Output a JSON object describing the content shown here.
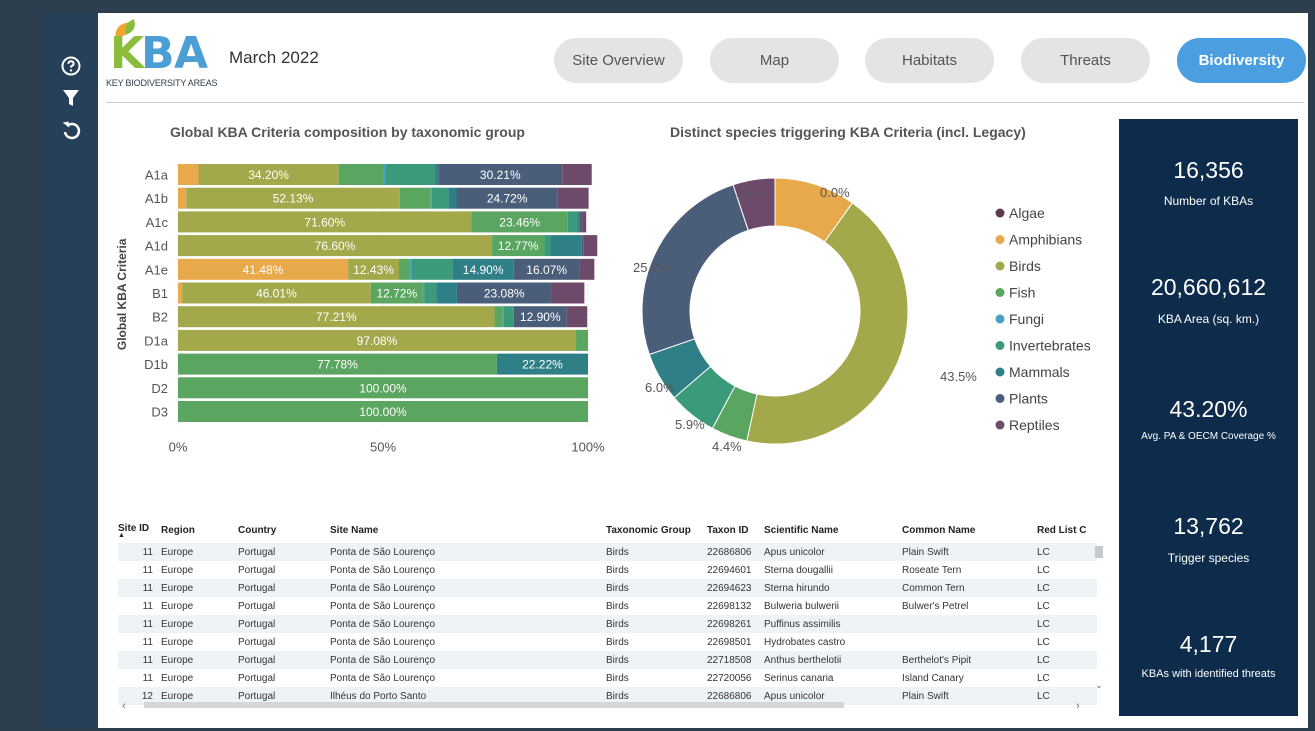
{
  "header": {
    "logo_text": "KBA",
    "logo_subtitle": "KEY BIODIVERSITY AREAS",
    "date": "March 2022",
    "nav": [
      "Site Overview",
      "Map",
      "Habitats",
      "Threats",
      "Biodiversity"
    ],
    "active_nav": "Biodiversity"
  },
  "sidebar": {
    "icons": [
      "help-icon",
      "filter-icon",
      "reset-icon"
    ]
  },
  "colors": {
    "Algae": "#5e3a4e",
    "Amphibians": "#e8a94b",
    "Birds": "#a3a94b",
    "Fish": "#5aa55f",
    "Fungi": "#4aa0c0",
    "Invertebrates": "#3a9a7a",
    "Mammals": "#2e7f86",
    "Plants": "#4a5e7a",
    "Reptiles": "#6e4a6a"
  },
  "bar_chart": {
    "title": "Global KBA Criteria composition by taxonomic group",
    "ylabel": "Global KBA Criteria",
    "xticks": [
      "0%",
      "50%",
      "100%"
    ]
  },
  "donut_chart": {
    "title": "Distinct species triggering KBA Criteria (incl. Legacy)"
  },
  "chart_data": [
    {
      "type": "bar",
      "stacked": true,
      "orientation": "horizontal",
      "title": "Global KBA Criteria composition by taxonomic group",
      "ylabel": "Global KBA Criteria",
      "xlim": [
        0,
        100
      ],
      "xticks": [
        "0%",
        "50%",
        "100%"
      ],
      "categories": [
        "A1a",
        "A1b",
        "A1c",
        "A1d",
        "A1e",
        "B1",
        "B2",
        "D1a",
        "D1b",
        "D2",
        "D3"
      ],
      "series": [
        {
          "name": "Amphibians",
          "values": [
            5,
            2,
            0,
            0,
            41.48,
            1,
            0,
            0,
            0,
            0,
            0
          ]
        },
        {
          "name": "Birds",
          "values": [
            34.2,
            52.13,
            71.6,
            76.6,
            12.43,
            46.01,
            77.21,
            97.08,
            0,
            0,
            0
          ]
        },
        {
          "name": "Fish",
          "values": [
            10.8,
            7.5,
            23.46,
            12.77,
            2.57,
            12.72,
            2,
            2.92,
            77.78,
            100,
            100
          ]
        },
        {
          "name": "Fungi",
          "values": [
            0.6,
            0.3,
            0,
            0,
            0.5,
            0.3,
            0.2,
            0,
            0,
            0,
            0
          ]
        },
        {
          "name": "Invertebrates",
          "values": [
            12.1,
            4,
            2.5,
            1.5,
            10,
            3,
            2.5,
            0,
            0,
            0,
            0
          ]
        },
        {
          "name": "Mammals",
          "values": [
            0.8,
            2,
            0.4,
            7.6,
            14.9,
            5,
            0,
            0,
            22.22,
            0,
            0
          ]
        },
        {
          "name": "Plants",
          "values": [
            30.21,
            24.72,
            0.6,
            0.5,
            16.07,
            23.08,
            12.9,
            0,
            0,
            0,
            0
          ]
        },
        {
          "name": "Reptiles",
          "values": [
            7.2,
            7.5,
            1,
            3.3,
            3.6,
            8,
            5,
            0,
            0,
            0,
            0
          ]
        }
      ],
      "data_labels": [
        {
          "row": 0,
          "series": "Birds",
          "text": "34.20%"
        },
        {
          "row": 0,
          "series": "Plants",
          "text": "30.21%"
        },
        {
          "row": 1,
          "series": "Birds",
          "text": "52.13%"
        },
        {
          "row": 1,
          "series": "Plants",
          "text": "24.72%"
        },
        {
          "row": 2,
          "series": "Birds",
          "text": "71.60%"
        },
        {
          "row": 2,
          "series": "Fish",
          "text": "23.46%"
        },
        {
          "row": 3,
          "series": "Birds",
          "text": "76.60%"
        },
        {
          "row": 3,
          "series": "Fish",
          "text": "12.77%"
        },
        {
          "row": 4,
          "series": "Amphibians",
          "text": "41.48%"
        },
        {
          "row": 4,
          "series": "Birds",
          "text": "12.43%"
        },
        {
          "row": 4,
          "series": "Mammals",
          "text": "14.90%"
        },
        {
          "row": 4,
          "series": "Plants",
          "text": "16.07%"
        },
        {
          "row": 5,
          "series": "Birds",
          "text": "46.01%"
        },
        {
          "row": 5,
          "series": "Fish",
          "text": "12.72%"
        },
        {
          "row": 5,
          "series": "Plants",
          "text": "23.08%"
        },
        {
          "row": 6,
          "series": "Birds",
          "text": "77.21%"
        },
        {
          "row": 6,
          "series": "Plants",
          "text": "12.90%"
        },
        {
          "row": 7,
          "series": "Birds",
          "text": "97.08%"
        },
        {
          "row": 8,
          "series": "Fish",
          "text": "77.78%"
        },
        {
          "row": 8,
          "series": "Mammals",
          "text": "22.22%"
        },
        {
          "row": 9,
          "series": "Fish",
          "text": "100.00%"
        },
        {
          "row": 10,
          "series": "Fish",
          "text": "100.00%"
        }
      ]
    },
    {
      "type": "pie",
      "donut": true,
      "title": "Distinct species triggering KBA Criteria (incl. Legacy)",
      "categories": [
        "Algae",
        "Amphibians",
        "Birds",
        "Fish",
        "Fungi",
        "Invertebrates",
        "Mammals",
        "Plants",
        "Reptiles"
      ],
      "values": [
        0.0,
        9.9,
        43.5,
        4.4,
        0.0,
        5.9,
        6.0,
        25.2,
        5.1
      ],
      "labels": [
        "0.0%",
        "",
        "43.5%",
        "4.4%",
        "",
        "5.9%",
        "6.0%",
        "25.2%",
        "5.1%"
      ],
      "legend": "right"
    }
  ],
  "stats": [
    {
      "value": "16,356",
      "label": "Number of KBAs"
    },
    {
      "value": "20,660,612",
      "label": "KBA Area (sq. km.)"
    },
    {
      "value": "43.20%",
      "label": "Avg. PA & OECM Coverage %"
    },
    {
      "value": "13,762",
      "label": "Trigger species"
    },
    {
      "value": "4,177",
      "label": "KBAs with identified threats"
    }
  ],
  "table": {
    "columns": [
      "Site ID",
      "Region",
      "Country",
      "Site Name",
      "Taxonomic Group",
      "Taxon ID",
      "Scientific Name",
      "Common Name",
      "Red List C"
    ],
    "rows": [
      [
        "11",
        "Europe",
        "Portugal",
        "Ponta de São Lourenço",
        "Birds",
        "22686806",
        "Apus unicolor",
        "Plain Swift",
        "LC"
      ],
      [
        "11",
        "Europe",
        "Portugal",
        "Ponta de São Lourenço",
        "Birds",
        "22694601",
        "Sterna dougallii",
        "Roseate Tern",
        "LC"
      ],
      [
        "11",
        "Europe",
        "Portugal",
        "Ponta de São Lourenço",
        "Birds",
        "22694623",
        "Sterna hirundo",
        "Common Tern",
        "LC"
      ],
      [
        "11",
        "Europe",
        "Portugal",
        "Ponta de São Lourenço",
        "Birds",
        "22698132",
        "Bulweria bulwerii",
        "Bulwer's Petrel",
        "LC"
      ],
      [
        "11",
        "Europe",
        "Portugal",
        "Ponta de São Lourenço",
        "Birds",
        "22698261",
        "Puffinus assimilis",
        "",
        "LC"
      ],
      [
        "11",
        "Europe",
        "Portugal",
        "Ponta de São Lourenço",
        "Birds",
        "22698501",
        "Hydrobates castro",
        "",
        "LC"
      ],
      [
        "11",
        "Europe",
        "Portugal",
        "Ponta de São Lourenço",
        "Birds",
        "22718508",
        "Anthus berthelotii",
        "Berthelot's Pipit",
        "LC"
      ],
      [
        "11",
        "Europe",
        "Portugal",
        "Ponta de São Lourenço",
        "Birds",
        "22720056",
        "Serinus canaria",
        "Island Canary",
        "LC"
      ],
      [
        "12",
        "Europe",
        "Portugal",
        "Ilhéus do Porto Santo",
        "Birds",
        "22686806",
        "Apus unicolor",
        "Plain Swift",
        "LC"
      ]
    ]
  }
}
